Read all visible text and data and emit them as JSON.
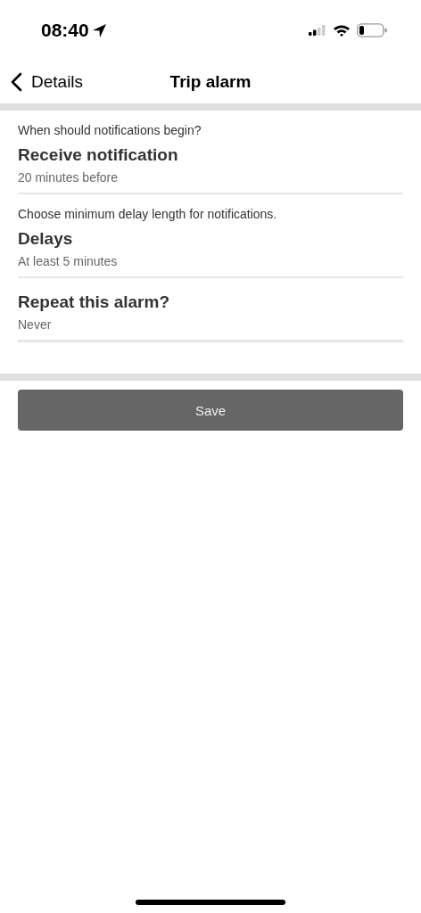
{
  "status_bar": {
    "time": "08:40"
  },
  "nav_bar": {
    "back_label": "Details",
    "title": "Trip alarm"
  },
  "settings": [
    {
      "hint": "When should notifications begin?",
      "title": "Receive notification",
      "value": "20 minutes before"
    },
    {
      "hint": "Choose minimum delay length for notifications.",
      "title": "Delays",
      "value": "At least 5 minutes"
    },
    {
      "title": "Repeat this alarm?",
      "value": "Never"
    }
  ],
  "save_button": {
    "label": "Save"
  }
}
